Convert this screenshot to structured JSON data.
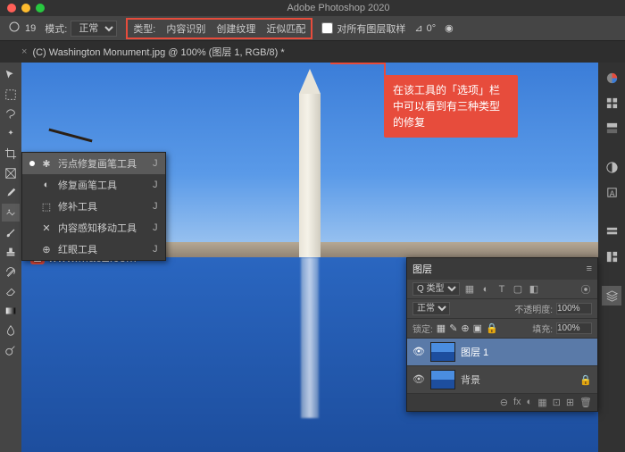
{
  "app": {
    "title": "Adobe Photoshop 2020"
  },
  "optionsBar": {
    "brushSize": "19",
    "modeLabel": "模式:",
    "mode": "正常",
    "typeLabel": "类型:",
    "type1": "内容识别",
    "type2": "创建纹理",
    "type3": "近似匹配",
    "sampleAll": "对所有图层取样",
    "angle": "0°"
  },
  "document": {
    "tab": "(C) Washington Monument.jpg @ 100% (图层 1, RGB/8) *"
  },
  "flyout": {
    "items": [
      {
        "label": "污点修复画笔工具",
        "shortcut": "J",
        "selected": true
      },
      {
        "label": "修复画笔工具",
        "shortcut": "J",
        "selected": false
      },
      {
        "label": "修补工具",
        "shortcut": "J",
        "selected": false
      },
      {
        "label": "内容感知移动工具",
        "shortcut": "J",
        "selected": false
      },
      {
        "label": "红眼工具",
        "shortcut": "J",
        "selected": false
      }
    ]
  },
  "callout": {
    "text": "在该工具的「选项」栏中可以看到有三种类型的修复"
  },
  "watermark": {
    "badge": "Z",
    "text": "www.MacZ.com"
  },
  "layersPanel": {
    "title": "图层",
    "filterKind": "Q 类型",
    "blendMode": "正常",
    "opacityLabel": "不透明度:",
    "opacity": "100%",
    "lockLabel": "锁定:",
    "fillLabel": "填充:",
    "fill": "100%",
    "layers": [
      {
        "name": "图层 1",
        "visible": true,
        "selected": true
      },
      {
        "name": "背景",
        "visible": true,
        "selected": false
      }
    ],
    "footerIcons": [
      "⊖",
      "fx",
      "◐",
      "▦",
      "⊡",
      "⊞",
      "🗑"
    ]
  },
  "colors": {
    "accent": "#e74c3c",
    "panel": "#454545",
    "bg": "#323232"
  }
}
